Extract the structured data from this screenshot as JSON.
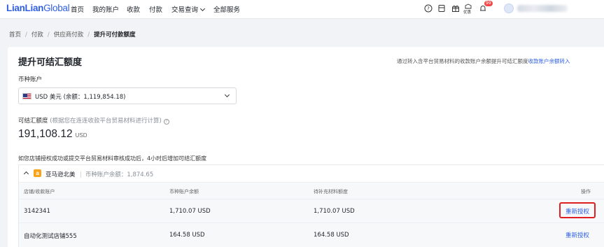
{
  "brand": {
    "name_part1": "LianLian",
    "name_part2": "Global"
  },
  "nav": {
    "items": [
      {
        "label": "首页"
      },
      {
        "label": "我的账户"
      },
      {
        "label": "收款"
      },
      {
        "label": "付款"
      },
      {
        "label": "交易查询"
      },
      {
        "label": "全部服务"
      }
    ],
    "promo_label": "优惠",
    "notification_count": "99",
    "icons": [
      "help-icon",
      "document-icon",
      "gift-icon",
      "promo-icon",
      "bell-icon"
    ]
  },
  "breadcrumb": {
    "items": [
      "首页",
      "付款",
      "供应商付款"
    ],
    "current": "提升可付款额度"
  },
  "page": {
    "title": "提升可结汇额度",
    "tip_text": "通过转入含平台贸易材料的收款账户余额提升可结汇额度",
    "tip_link": "收款账户余额转入"
  },
  "currency_account": {
    "label": "币种账户",
    "selected": "USD 美元 (余额：1,119,854.18)"
  },
  "limit": {
    "label": "可结汇额度",
    "sub": "(根据您在连连收款平台贸易材料进行计算)",
    "value": "191,108.12",
    "currency": "USD"
  },
  "notice": "如您店铺授权成功或提交平台贸易材料审核成功后，4小时后增加可结汇额度",
  "store_group": {
    "name": "亚马逊北美",
    "balance": "币种账户余额：1,874.65"
  },
  "table": {
    "headers": [
      "店铺/收款账户",
      "币种账户余额",
      "待补充材料额度",
      "操作"
    ],
    "rows": [
      {
        "account": "3142341",
        "balance": "1,710.07 USD",
        "pending": "1,710.07 USD",
        "action": "重新授权"
      },
      {
        "account": "自动化测试店铺555",
        "balance": "164.58 USD",
        "pending": "164.58 USD",
        "action": "重新授权"
      }
    ]
  },
  "colors": {
    "brand": "#2f5fe3",
    "link": "#2f5fe3",
    "highlight": "#e02020",
    "amazon": "#f7a31c"
  }
}
